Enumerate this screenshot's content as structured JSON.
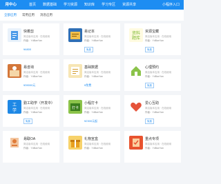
{
  "header": {
    "brand": "用中心",
    "nav": [
      "首页",
      "数据基础",
      "学习资源",
      "知识库",
      "学习专区",
      "资源共享"
    ],
    "right": "小程序入口"
  },
  "filters": [
    "全部应用",
    "常用应用",
    "消息应用"
  ],
  "colors": {
    "accent": "#1d8df2"
  },
  "cards": [
    {
      "title": "快着剪",
      "desc": "简洁版本应用 · 在线使用",
      "author": "作者：YdBanYan",
      "price": "¥4800",
      "tag": ""
    },
    {
      "title": "易记本",
      "desc": "简洁版本应用 · 在线使用",
      "author": "作者：YdBanYan",
      "price": "",
      "tag": "免费"
    },
    {
      "title": "资源宝藏",
      "desc": "简洁版本应用 · 在线使用",
      "author": "作者：YdBanYan",
      "price": "",
      "tag": "免费"
    },
    {
      "title": "易咨询",
      "desc": "简洁版本应用 · 在线使用",
      "author": "作者：YdBanYan",
      "price": "¥39000元",
      "tag": ""
    },
    {
      "title": "基础数据",
      "desc": "简洁版本应用 · 在线使用",
      "author": "作者：YdBanYan",
      "price": "¥免费",
      "tag": ""
    },
    {
      "title": "心理预约",
      "desc": "简洁版本应用 · 在线使用",
      "author": "作者：YdBanYan",
      "price": "",
      "tag": "免费"
    },
    {
      "title": "勤工助学（开发中）",
      "desc": "简洁版本应用 · 在线使用",
      "author": "作者：YdBanYan",
      "price": "",
      "tag": "免费"
    },
    {
      "title": "小程打卡",
      "desc": "简洁版本应用 · 在线使用",
      "author": "作者：YdBanYan",
      "price": "¥2300元起",
      "tag": ""
    },
    {
      "title": "爱心互助",
      "desc": "简洁版本应用 · 在线使用",
      "author": "作者：YdBanYan",
      "price": "",
      "tag": "免费"
    },
    {
      "title": "易联OA",
      "desc": "简洁版本应用 · 在线使用",
      "author": "作者：YdBanYan",
      "price": "",
      "tag": ""
    },
    {
      "title": "礼物宣盒",
      "desc": "简洁版本应用 · 在线使用",
      "author": "作者：YdBanYan",
      "price": "",
      "tag": ""
    },
    {
      "title": "重点专项",
      "desc": "简洁版本应用 · 在线使用",
      "author": "作者：YdBanYan",
      "price": "",
      "tag": ""
    }
  ]
}
